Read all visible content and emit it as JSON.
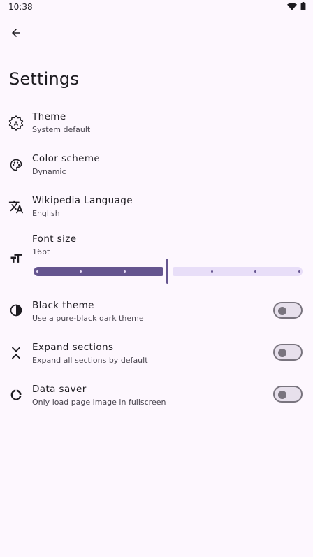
{
  "status": {
    "time": "10:38"
  },
  "page": {
    "title": "Settings"
  },
  "settings": {
    "theme": {
      "title": "Theme",
      "value": "System default",
      "icon": "theme-icon"
    },
    "color_scheme": {
      "title": "Color scheme",
      "value": "Dynamic",
      "icon": "palette-icon"
    },
    "language": {
      "title": "Wikipedia Language",
      "value": "English",
      "icon": "translate-icon"
    },
    "font_size": {
      "title": "Font size",
      "value": "16pt",
      "icon": "text-size-icon",
      "steps": 7,
      "selected_step": 3
    },
    "black_theme": {
      "title": "Black theme",
      "subtitle": "Use a pure-black dark theme",
      "enabled": false,
      "icon": "contrast-icon"
    },
    "expand_sections": {
      "title": "Expand sections",
      "subtitle": "Expand all sections by default",
      "enabled": false,
      "icon": "expand-icon"
    },
    "data_saver": {
      "title": "Data saver",
      "subtitle": "Only load page image in fullscreen",
      "enabled": false,
      "icon": "data-saver-icon"
    }
  },
  "colors": {
    "background": "#fdf7fe",
    "primary": "#65558f",
    "primary_container": "#e8def8",
    "outline": "#79747e"
  }
}
